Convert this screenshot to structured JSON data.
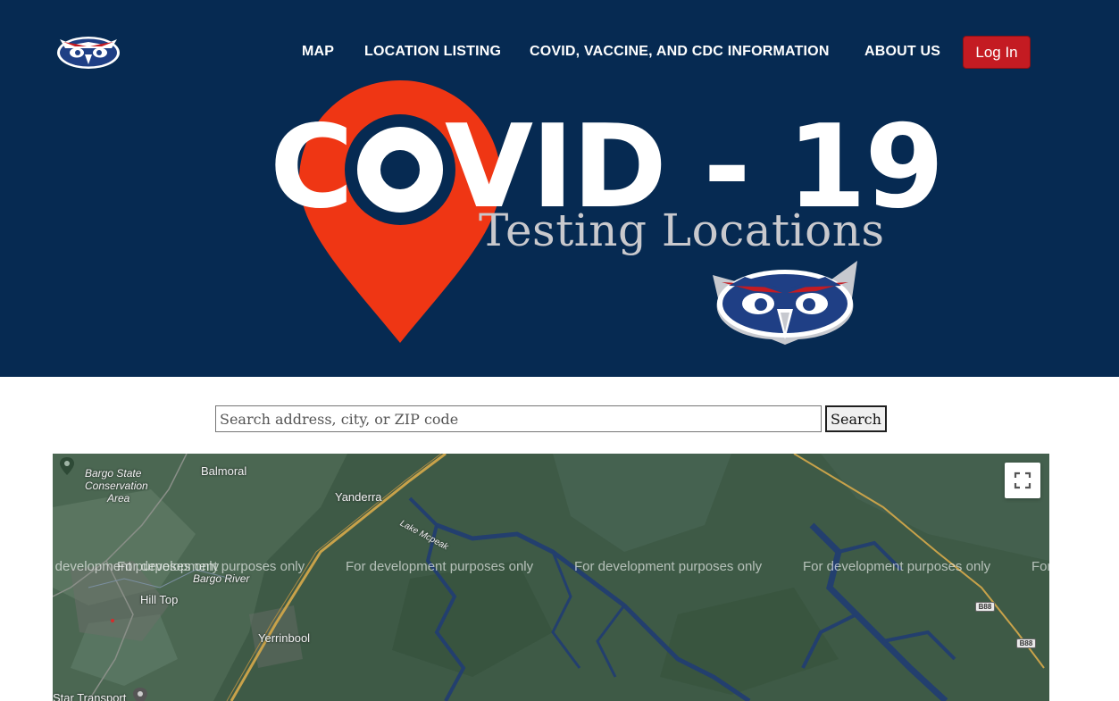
{
  "nav": {
    "items": [
      {
        "label": "MAP"
      },
      {
        "label": "LOCATION LISTING"
      },
      {
        "label": "COVID, VACCINE, AND CDC INFORMATION"
      },
      {
        "label": "ABOUT US"
      }
    ],
    "login_label": "Log In"
  },
  "hero": {
    "title_left": "C",
    "title_right": "VID - 19",
    "subtitle": "Testing Locations"
  },
  "search": {
    "placeholder": "Search address, city, or ZIP code",
    "button_label": "Search"
  },
  "map": {
    "watermark": "For development purposes only",
    "places": {
      "bargo_state": "Bargo State",
      "conservation": "Conservation",
      "area": "Area",
      "balmoral": "Balmoral",
      "yanderra": "Yanderra",
      "lake_mcpeake": "Lake Mcpeak",
      "bargo_river": "Bargo River",
      "hill_top": "Hill Top",
      "yerrinbool": "Yerrinbool",
      "star_transport": "Star Transport"
    },
    "road_shield": "B88",
    "colors": {
      "terrain": "#3e5a46",
      "water": "#233f6e",
      "roads": "#c8a24a"
    }
  },
  "colors": {
    "header_bg": "#062a52",
    "login_bg": "#c41b22",
    "pin_red": "#ef3614"
  }
}
